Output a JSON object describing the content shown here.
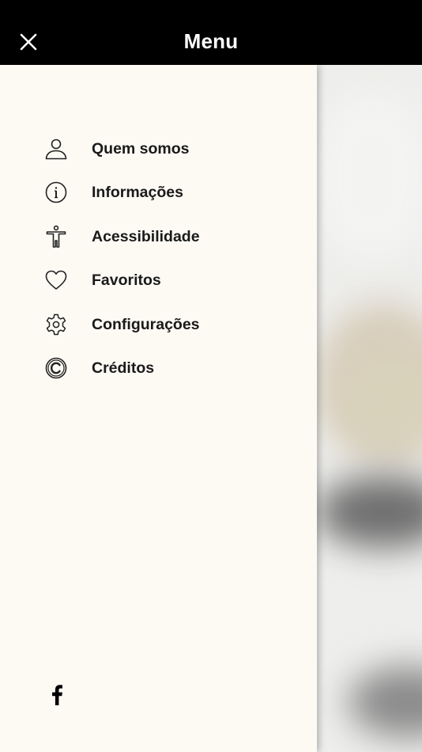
{
  "header": {
    "title": "Menu",
    "close_icon": "close-icon"
  },
  "menu": {
    "items": [
      {
        "label": "Quem somos",
        "icon": "user-icon"
      },
      {
        "label": "Informações",
        "icon": "info-icon"
      },
      {
        "label": "Acessibilidade",
        "icon": "accessibility-icon"
      },
      {
        "label": "Favoritos",
        "icon": "heart-icon"
      },
      {
        "label": "Configurações",
        "icon": "gear-icon"
      },
      {
        "label": "Créditos",
        "icon": "copyright-icon"
      }
    ]
  },
  "social": {
    "facebook_icon": "facebook-icon"
  },
  "colors": {
    "header_bg": "#000000",
    "drawer_bg": "#fdfaf4",
    "text": "#1a1a1a",
    "header_text": "#ffffff"
  }
}
